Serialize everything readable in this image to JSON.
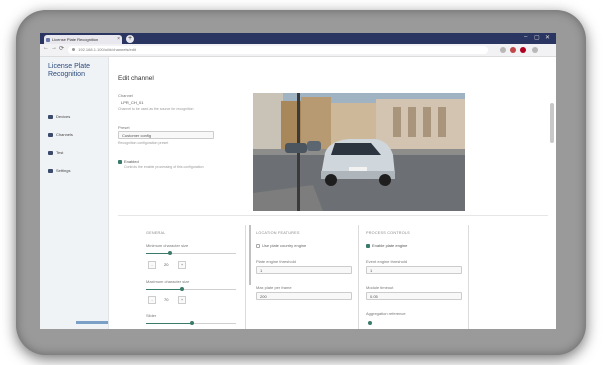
{
  "browser": {
    "tab_title": "License Plate Recognition",
    "new_tab_symbol": "+",
    "address": "192.168.1.100/ui/#/channels/edit",
    "nav": {
      "back": "←",
      "forward": "→",
      "reload": "⟳"
    },
    "window_controls": {
      "minimize": "–",
      "maximize": "▢",
      "close": "✕"
    }
  },
  "sidebar": {
    "brand": "License Plate Recognition",
    "items": [
      {
        "label": "Devices",
        "icon": "device-icon"
      },
      {
        "label": "Channels",
        "icon": "camera-icon"
      },
      {
        "label": "Test",
        "icon": "test-icon"
      },
      {
        "label": "Settings",
        "icon": "gear-icon"
      }
    ]
  },
  "main": {
    "title": "Edit channel",
    "channel": {
      "label": "Channel",
      "value": "LPR_CH_01",
      "help": "Channel to be used as the source for recognition"
    },
    "preset": {
      "label": "Preset",
      "value": "Customer config",
      "help": "Recognition configuration preset"
    },
    "enabled": {
      "label": "Enabled",
      "help": "Controls the enable processing of this configuration"
    }
  },
  "sections": {
    "general": {
      "title": "GENERAL",
      "min_char": {
        "label": "Minimum character size",
        "value": "20"
      },
      "max_char": {
        "label": "Maximum character size",
        "value": "70"
      },
      "slider3": {
        "label": "Slider"
      }
    },
    "location": {
      "title": "LOCATION FEATURES",
      "use_regions": {
        "label": "Use plate country engine"
      },
      "plate_engine": {
        "label": "Plate engine threshold",
        "value": "1"
      },
      "max_plate": {
        "label": "Max plate per frame",
        "value": "200"
      }
    },
    "classifier": {
      "title": "PROCESS CONTROLS",
      "enable_engine": {
        "label": "Enable plate engine"
      },
      "event_engine": {
        "label": "Event engine threshold",
        "value": "1"
      },
      "module_timeout": {
        "label": "Module timeout",
        "value": "0.05"
      },
      "aggregation": {
        "label": "Aggregation reference"
      }
    }
  },
  "colors": {
    "tab_bar": "#2b3561",
    "accent": "#3a7a6a",
    "brand": "#2a4a7a",
    "frame": "#9a9a9a"
  }
}
